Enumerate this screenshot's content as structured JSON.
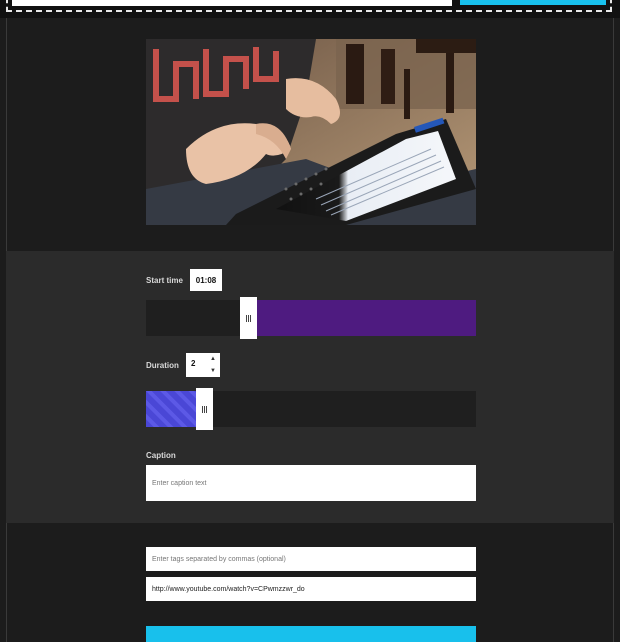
{
  "top": {
    "url_input_value": "",
    "action_button_label": ""
  },
  "video": {
    "thumbnail_icon": "video-thumbnail"
  },
  "start_time": {
    "label": "Start time",
    "value": "01:08",
    "position_fraction": 0.31
  },
  "duration": {
    "label": "Duration",
    "value": "2",
    "fill_fraction": 0.15
  },
  "caption": {
    "label": "Caption",
    "placeholder": "Enter caption text",
    "value": ""
  },
  "tags": {
    "placeholder": "Enter tags separated by commas (optional)",
    "value": ""
  },
  "youtube_url": {
    "value": "http://www.youtube.com/watch?v=CPwmzzwr_do"
  },
  "submit": {
    "label": ""
  },
  "colors": {
    "accent_cyan": "#18c0ec",
    "start_track_fill": "#4e1b80",
    "duration_fill": "#4a47d6",
    "panel_bg": "#2b2b2b",
    "page_bg": "#1c1c1c"
  }
}
